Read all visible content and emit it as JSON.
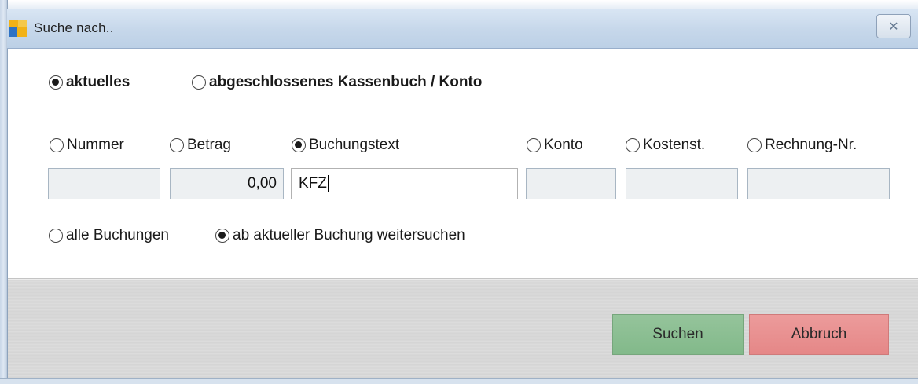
{
  "window": {
    "title": "Suche nach..",
    "close_icon": "close-icon"
  },
  "scope": {
    "options": [
      {
        "label": "aktuelles",
        "selected": true
      },
      {
        "label": "abgeschlossenes Kassenbuch / Konto",
        "selected": false
      }
    ]
  },
  "search_fields": {
    "options": [
      {
        "label": "Nummer",
        "selected": false,
        "value": ""
      },
      {
        "label": "Betrag",
        "selected": false,
        "value": "0,00"
      },
      {
        "label": "Buchungstext",
        "selected": true,
        "value": "KFZ"
      },
      {
        "label": "Konto",
        "selected": false,
        "value": ""
      },
      {
        "label": "Kostenst.",
        "selected": false,
        "value": ""
      },
      {
        "label": "Rechnung-Nr.",
        "selected": false,
        "value": ""
      }
    ]
  },
  "range": {
    "options": [
      {
        "label": "alle Buchungen",
        "selected": false
      },
      {
        "label": "ab aktueller Buchung weitersuchen",
        "selected": true
      }
    ]
  },
  "buttons": {
    "search": "Suchen",
    "cancel": "Abbruch"
  },
  "colors": {
    "search_button": "#8cc093",
    "cancel_button": "#e89191"
  }
}
